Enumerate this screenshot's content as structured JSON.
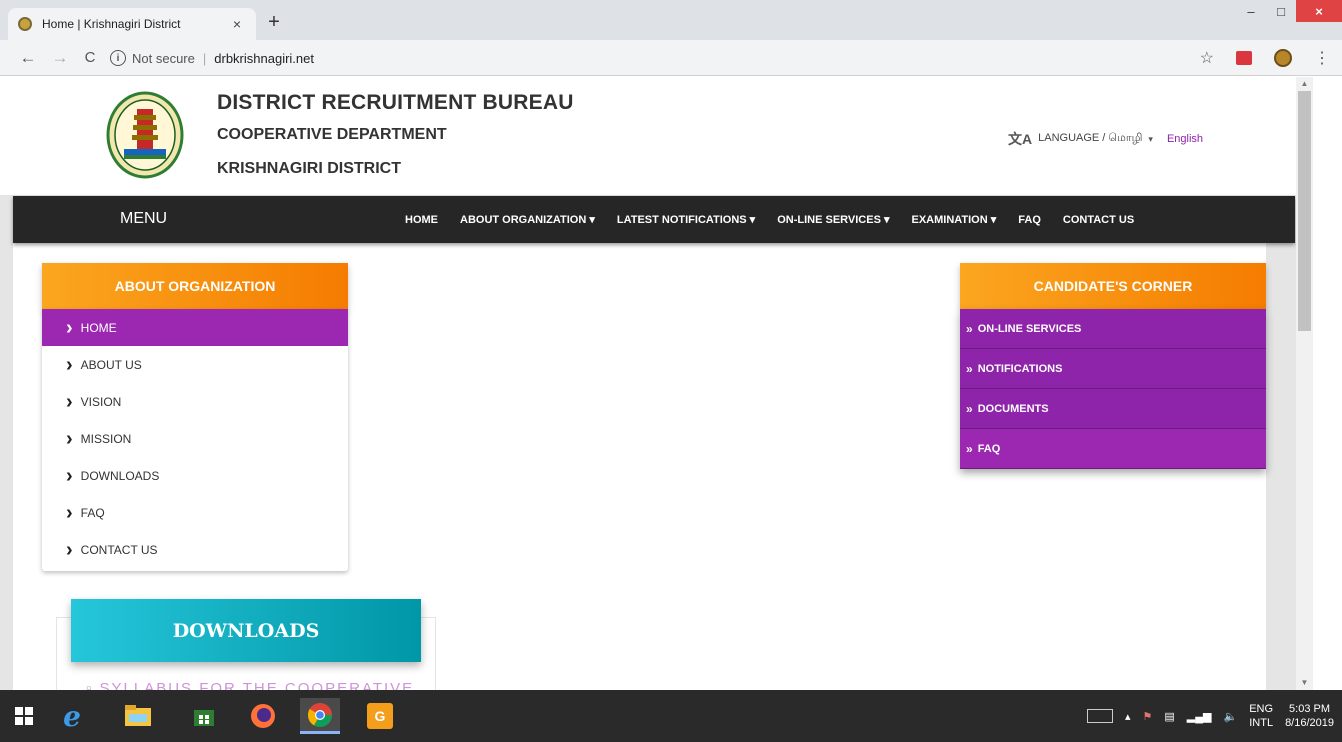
{
  "browser": {
    "tab_title": "Home | Krishnagiri District",
    "tab_close": "×",
    "new_tab": "+",
    "security_label": "Not secure",
    "url": "drbkrishnagiri.net",
    "back": "←",
    "forward": "→",
    "reload": "C",
    "star": "☆",
    "kebab": "⋮",
    "minimize": "–",
    "maximize": "□",
    "close": "×"
  },
  "header": {
    "title": "DISTRICT RECRUITMENT BUREAU",
    "subtitle1": "COOPERATIVE DEPARTMENT",
    "subtitle2": "KRISHNAGIRI DISTRICT",
    "language_icon": "文A",
    "language_label": "LANGUAGE / மொழி",
    "language_caret": "▾",
    "language_value": "English"
  },
  "navbar": {
    "menu_label": "MENU",
    "links": [
      {
        "label": "HOME"
      },
      {
        "label": "ABOUT ORGANIZATION ▾"
      },
      {
        "label": "LATEST NOTIFICATIONS ▾"
      },
      {
        "label": "ON-LINE SERVICES ▾"
      },
      {
        "label": "EXAMINATION ▾"
      },
      {
        "label": "FAQ"
      },
      {
        "label": "CONTACT US"
      }
    ]
  },
  "left_panel": {
    "heading": "ABOUT ORGANIZATION",
    "items": [
      {
        "label": "HOME"
      },
      {
        "label": "ABOUT US"
      },
      {
        "label": "VISION"
      },
      {
        "label": "MISSION"
      },
      {
        "label": "DOWNLOADS"
      },
      {
        "label": "FAQ"
      },
      {
        "label": "CONTACT US"
      }
    ]
  },
  "right_panel": {
    "heading": "CANDIDATE'S CORNER",
    "items": [
      {
        "label": "ON-LINE SERVICES"
      },
      {
        "label": "NOTIFICATIONS"
      },
      {
        "label": "DOCUMENTS"
      },
      {
        "label": "FAQ"
      }
    ]
  },
  "downloads": {
    "heading": "DOWNLOADS",
    "first_item": "SYLLABUS FOR THE COOPERATIVE"
  },
  "taskbar": {
    "lang_top": "ENG",
    "lang_bottom": "INTL",
    "time": "5:03 PM",
    "date": "8/16/2019"
  },
  "colors": {
    "orange": "#f57c00",
    "purple": "#9c27b0",
    "teal": "#0097a7",
    "navbar": "#262626"
  }
}
